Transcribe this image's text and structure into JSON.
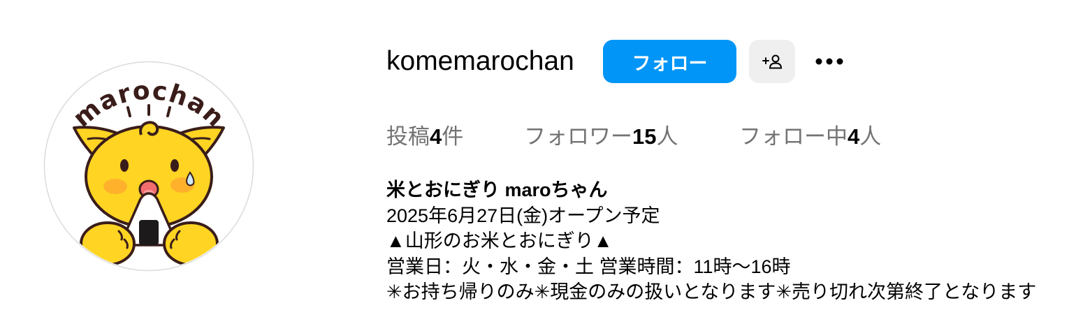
{
  "profile": {
    "username": "komemarochan",
    "avatar_logo_text": "marochan"
  },
  "actions": {
    "follow_label": "フォロー",
    "add_person_icon": "person-add-icon",
    "more_icon": "more-horizontal-icon"
  },
  "stats": {
    "posts": {
      "label": "投稿",
      "value": "4",
      "unit": "件"
    },
    "followers": {
      "label": "フォロワー",
      "value": "15",
      "unit": "人"
    },
    "following": {
      "label": "フォロー中",
      "value": "4",
      "unit": "人"
    }
  },
  "bio": {
    "name": "米とおにぎり maroちゃん",
    "lines": [
      "2025年6月27日(金)オープン予定",
      "▲山形のお米とおにぎり▲",
      "営業日：火・水・金・土 営業時間：11時〜16時",
      "✳お持ち帰りのみ✳現金のみの扱いとなります✳売り切れ次第終了となります"
    ]
  },
  "colors": {
    "primary_button": "#0095F6",
    "secondary_button": "#EFEFEF",
    "text_primary": "#000000",
    "text_secondary": "#737373",
    "avatar_border": "#DBDBDB",
    "mascot_yellow": "#FFD423",
    "mascot_outline": "#3A1D1A"
  }
}
